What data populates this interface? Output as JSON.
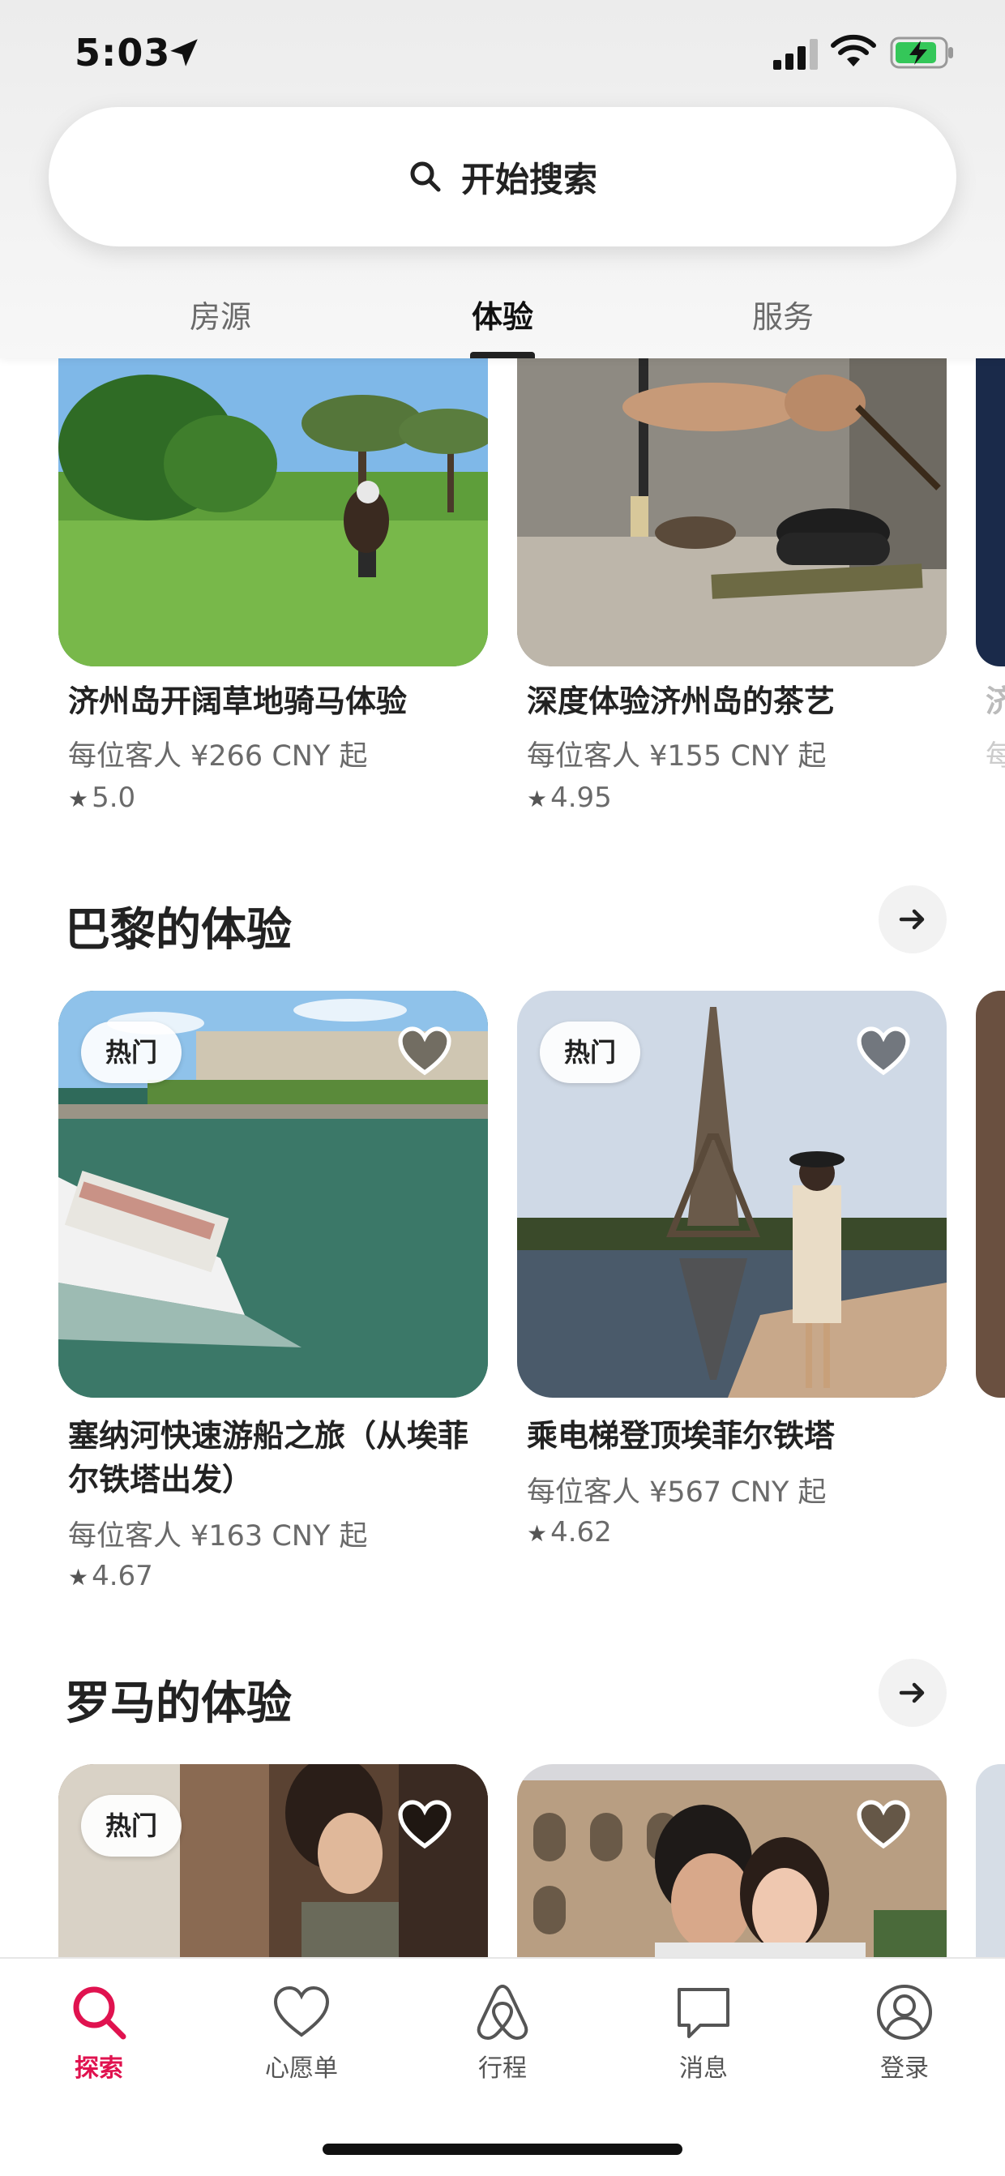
{
  "status_bar": {
    "time": "5:03"
  },
  "search": {
    "label": "开始搜索"
  },
  "tabs": [
    {
      "label": "房源",
      "active": false
    },
    {
      "label": "体验",
      "active": true
    },
    {
      "label": "服务",
      "active": false
    }
  ],
  "top_row": [
    {
      "title": "济州岛开阔草地骑马体验",
      "price": "每位客人 ¥266 CNY 起",
      "rating": "5.0"
    },
    {
      "title": "深度体验济州岛的茶艺",
      "price": "每位客人 ¥155 CNY 起",
      "rating": "4.95"
    },
    {
      "title": "济",
      "price": "每",
      "rating": ""
    }
  ],
  "sections": [
    {
      "title": "巴黎的体验",
      "cards": [
        {
          "badge": "热门",
          "title": "塞纳河快速游船之旅（从埃菲尔铁塔出发）",
          "price": "每位客人 ¥163 CNY 起",
          "rating": "4.67"
        },
        {
          "badge": "热门",
          "title": "乘电梯登顶埃菲尔铁塔",
          "price": "每位客人 ¥567 CNY 起",
          "rating": "4.62"
        }
      ]
    },
    {
      "title": "罗马的体验",
      "cards": [
        {
          "badge": "热门"
        },
        {
          "badge": ""
        }
      ]
    }
  ],
  "bottom_nav": [
    {
      "label": "探索",
      "icon": "search-icon",
      "active": true
    },
    {
      "label": "心愿单",
      "icon": "heart-icon",
      "active": false
    },
    {
      "label": "行程",
      "icon": "airbnb-logo-icon",
      "active": false
    },
    {
      "label": "消息",
      "icon": "message-icon",
      "active": false
    },
    {
      "label": "登录",
      "icon": "profile-icon",
      "active": false
    }
  ],
  "colors": {
    "accent": "#e0124f",
    "text": "#222222",
    "muted": "#6a6a6a"
  }
}
